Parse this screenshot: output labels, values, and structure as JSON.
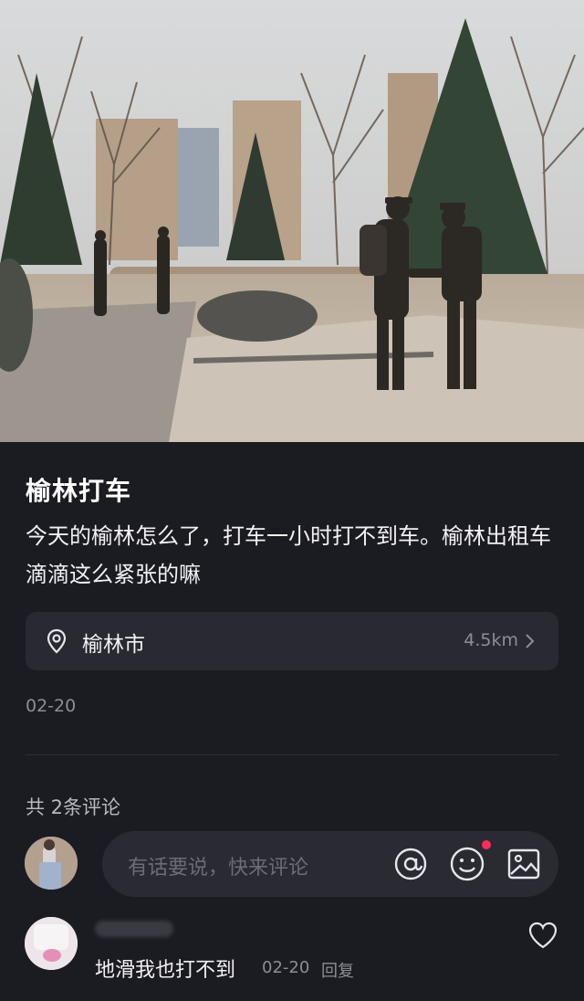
{
  "post": {
    "title": "榆林打车",
    "description": "今天的榆林怎么了，打车一小时打不到车。榆林出租车滴滴这么紧张的嘛",
    "location": {
      "name": "榆林市",
      "distance": "4.5km",
      "icon": "location-pin-icon"
    },
    "date": "02-20"
  },
  "comments": {
    "count_label": "共 2条评论",
    "input_placeholder": "有话要说，快来评论",
    "buttons": [
      "at-icon",
      "emoji-icon",
      "image-icon"
    ],
    "items": [
      {
        "text": "地滑我也打不到",
        "date": "02-20",
        "reply_label": "回复"
      }
    ]
  },
  "colors": {
    "background": "#1b1b22",
    "card": "#292931",
    "accent_dot": "#ff2d55"
  }
}
